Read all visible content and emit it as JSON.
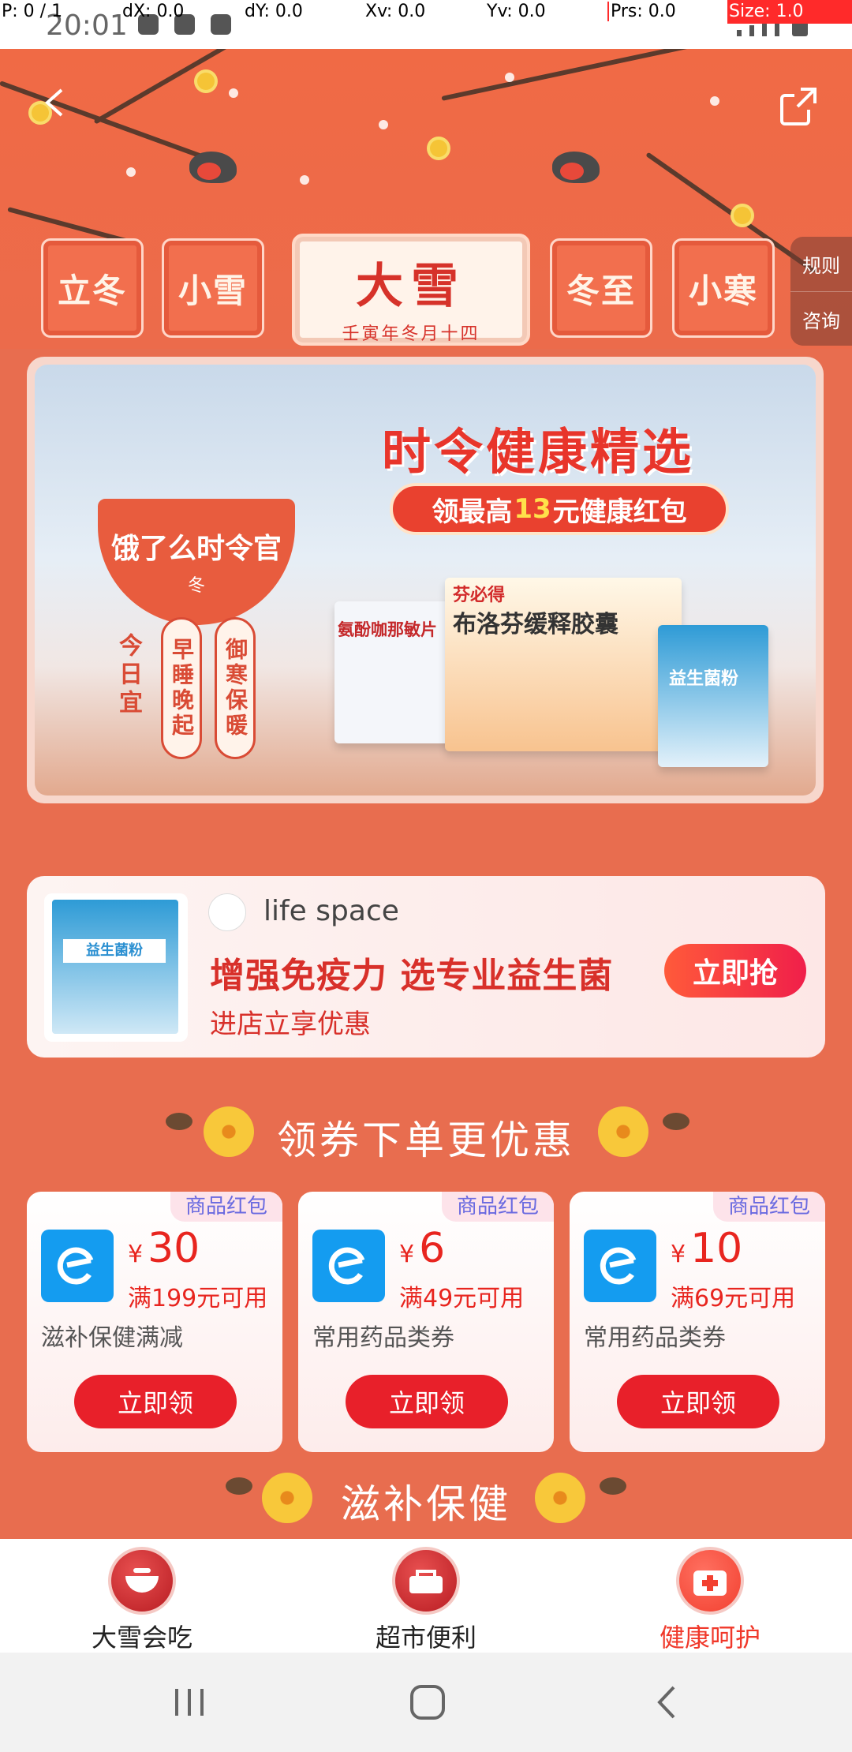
{
  "debug": {
    "p": "P: 0 / 1",
    "dx": "dX: 0.0",
    "dy": "dY: 0.0",
    "xv": "Xv: 0.0",
    "yv": "Yv: 0.0",
    "prs": "Prs: 0.0",
    "size": "Size: 1.0"
  },
  "status_bar": {
    "time": "20:01"
  },
  "solar_terms": {
    "items": [
      "立冬",
      "小雪",
      "冬至",
      "小寒"
    ],
    "active": {
      "name": "大雪",
      "lunar_date": "壬寅年冬月十四"
    }
  },
  "side_tabs": {
    "rules": "规则",
    "consult": "咨询"
  },
  "banner": {
    "title": "时令健康精选",
    "pill_prefix": "领最高",
    "pill_amount": "13",
    "pill_suffix": "元健康红包",
    "badge_title": "饿了么时令官",
    "badge_sub": "冬",
    "today": "今日宜",
    "tip1": "早睡晚起",
    "tip2": "御寒保暖",
    "product1": "氨酚咖那敏片",
    "product2": "布洛芬缓释胶囊",
    "product2_brand": "芬必得",
    "product3": "益生菌粉"
  },
  "store": {
    "name": "life space",
    "slogan": "增强免疫力 选专业益生菌",
    "subtitle": "进店立享优惠",
    "button": "立即抢",
    "box_label": "益生菌粉"
  },
  "coupon_section": {
    "title": "领券下单更优惠"
  },
  "coupons": [
    {
      "tag": "商品红包",
      "currency": "¥",
      "amount": "30",
      "condition": "满199元可用",
      "desc": "滋补保健满减",
      "button": "立即领"
    },
    {
      "tag": "商品红包",
      "currency": "¥",
      "amount": "6",
      "condition": "满49元可用",
      "desc": "常用药品类券",
      "button": "立即领"
    },
    {
      "tag": "商品红包",
      "currency": "¥",
      "amount": "10",
      "condition": "满69元可用",
      "desc": "常用药品类券",
      "button": "立即领"
    }
  ],
  "next_section": {
    "title": "滋补保健"
  },
  "bottom_nav": [
    {
      "label": "大雪会吃"
    },
    {
      "label": "超市便利"
    },
    {
      "label": "健康呵护"
    }
  ],
  "colors": {
    "background": "#e86d4f",
    "accent_red": "#e8202a",
    "active_nav": "#f0382a",
    "coupon_tag_text": "#6a6ae0"
  }
}
